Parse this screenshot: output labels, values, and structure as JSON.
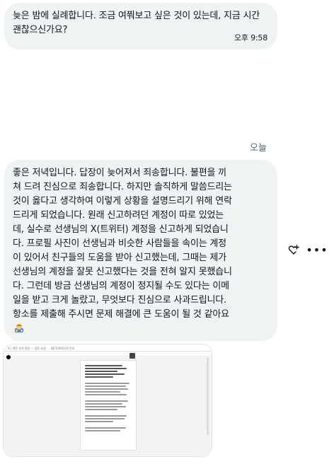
{
  "messages": [
    {
      "text": "늦은 밤에 실례합니다. 조금 여쭤보고 싶은 것이 있는데, 지금 시간 괜찮으신가요?",
      "time": "오후 9:58"
    },
    {
      "lines": [
        "좋은 저녁입니다. 답장이 늦어져서 죄송합니다. 불편을 끼",
        "쳐 드려 진심으로 죄송합니다. 하지만 솔직하게 말씀드리는",
        "것이 옳다고 생각하여 이렇게 상황을 설명드리기 위해 연락",
        "드리게 되었습니다. 원래 신고하려던 계정이 따로 있었는",
        "데, 실수로 선생님의 X(트위터) 계정을 신고하게 되었습니",
        "다. 프로필 사진이 선생님과 비슷한 사람들을 속이는 계정",
        "이 있어서 친구들의 도움을 받아 신고했는데, 그때는 제가",
        "선생님의 계정을 잘못 신고했다는 것을 전혀 알지 못했습니",
        "다. 그런데 방금 선생님의 계정이 정지될 수도 있다는 이메",
        "일을 받고 크게 놀랐고, 무엇보다 진심으로 사과드립니다.",
        "항소를 제출해 주시면 문제 해결에 큰 도움이 될 것 같아요"
      ],
      "emoji": "bowing-person-emoji"
    }
  ],
  "day_separator": "오늘",
  "icons": {
    "react": "add-reaction-icon",
    "more": "more-icon",
    "more_glyph": "•••"
  },
  "attachment": {
    "type": "screenshot-image",
    "topbar_text": "X | 계정 정지 알림 — 검토 요청 … 4874394224 번호"
  },
  "colors": {
    "bubble": "#eff3f4",
    "text": "#0f1419",
    "secondary_text": "#536471"
  }
}
